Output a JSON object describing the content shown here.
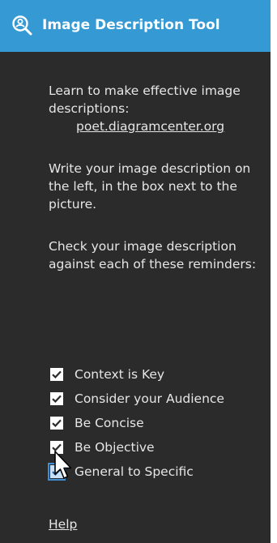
{
  "panel": {
    "title": "Image Description Tool",
    "title_icon": "magnifier-person-icon",
    "colors": {
      "title_bar": "#3599d4",
      "panel_bg": "#2b2b2b",
      "text": "#e6e6e6"
    }
  },
  "intro": {
    "learn_text": "Learn to make effective image descriptions:",
    "link_text": "poet.diagramcenter.org",
    "write_text": "Write your image description on the left, in the box next to the picture.",
    "check_text": "Check your image description against each of these reminders:"
  },
  "reminders": [
    {
      "label": "Context is Key",
      "checked": true
    },
    {
      "label": "Consider your Audience",
      "checked": true
    },
    {
      "label": "Be Concise",
      "checked": true
    },
    {
      "label": "Be Objective",
      "checked": true
    },
    {
      "label": "General to Specific",
      "checked": true
    }
  ],
  "footer": {
    "help_label": "Help"
  }
}
